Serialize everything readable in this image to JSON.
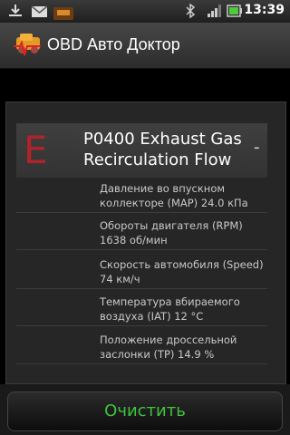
{
  "statusbar": {
    "time": "13:39"
  },
  "header": {
    "title": "OBD Авто Доктор"
  },
  "trouble_code": {
    "letter": "E",
    "title": "P0400 Exhaust Gas Recirculation Flow",
    "action": "-"
  },
  "parameters": [
    "Давление во впускном коллекторе (MAP) 24.0 кПа",
    "Обороты двигателя (RPM) 1638 об/мин",
    "Скорость автомобиля (Speed) 74 км/ч",
    "Температура вбираемого воздуха (IAT) 12 °C",
    "Положение дроссельной заслонки (TP) 14.9 %"
  ],
  "footer": {
    "clear_label": "Очистить"
  }
}
